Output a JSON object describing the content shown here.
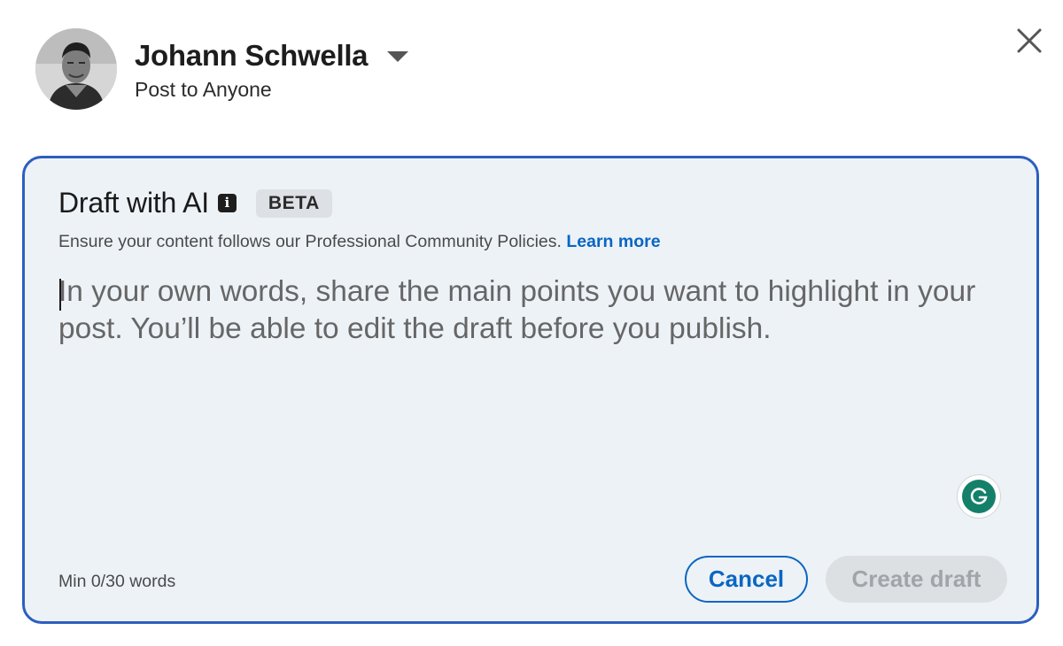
{
  "header": {
    "user_name": "Johann Schwella",
    "audience": "Post to Anyone",
    "avatar_icon": "user-avatar",
    "dropdown_icon": "chevron-down-icon",
    "close_icon": "close-icon"
  },
  "ai_panel": {
    "title": "Draft with AI",
    "info_icon": "info-icon",
    "badge": "BETA",
    "policy_text": "Ensure your content follows our Professional Community Policies.",
    "learn_more": "Learn more",
    "prompt_placeholder": "In your own words, share the main points you want to highlight in your post. You’ll be able to edit the draft before you publish.",
    "prompt_value": "",
    "grammarly_icon": "grammarly-icon",
    "word_count": "Min 0/30 words",
    "cancel_label": "Cancel",
    "create_label": "Create draft",
    "create_enabled": false
  },
  "colors": {
    "panel_border": "#2b5fbf",
    "panel_background": "#edf2f7",
    "link": "#0a66c2",
    "grammarly": "#15806a",
    "disabled_button": "#dde0e3"
  }
}
